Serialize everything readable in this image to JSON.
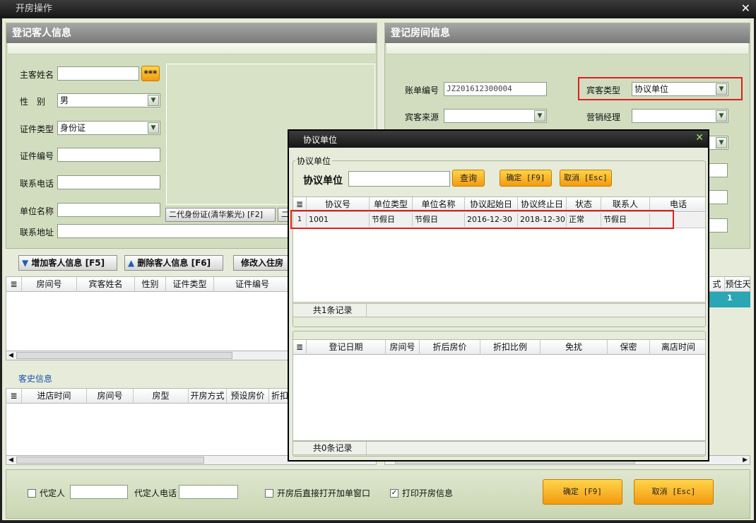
{
  "window": {
    "title": "开房操作",
    "close": "✕"
  },
  "guest_panel": {
    "title": "登记客人信息",
    "fields": {
      "name_label": "主客姓名",
      "name_value": "",
      "more_btn": "***",
      "gender_label": "性　别",
      "gender_value": "男",
      "idtype_label": "证件类型",
      "idtype_value": "身份证",
      "idno_label": "证件编号",
      "idno_value": "",
      "phone_label": "联系电话",
      "phone_value": "",
      "company_label": "单位名称",
      "company_value": "",
      "address_label": "联系地址",
      "address_value": ""
    },
    "id_reader_btn": "二代身份证(清华紫光) [F2]",
    "id_reader_btn2": "二"
  },
  "room_panel": {
    "title": "登记房间信息",
    "bill_label": "账单编号",
    "bill_value": "JZ201612300004",
    "guest_type_label": "宾客类型",
    "guest_type_value": "协议单位",
    "source_label": "宾客来源",
    "source_value": "",
    "manager_label": "营销经理",
    "manager_value": ""
  },
  "guest_toolbar": {
    "add": "增加客人信息 [F5]",
    "delete": "删除客人信息 [F6]",
    "modify": "修改入住房"
  },
  "guest_grid": {
    "columns": [
      "房间号",
      "宾客姓名",
      "性别",
      "证件类型",
      "证件编号"
    ],
    "right_columns": [
      "式",
      "预住天"
    ],
    "right_value": "1"
  },
  "history": {
    "title": "客史信息",
    "columns": [
      "进店时间",
      "房间号",
      "房型",
      "开房方式",
      "预设房价",
      "折扣"
    ]
  },
  "footer": {
    "agent_label": "代定人",
    "agent_value": "",
    "agent_phone_label": "代定人电话",
    "agent_phone_value": "",
    "open_window_label": "开房后直接打开加单窗口",
    "open_window_checked": false,
    "print_label": "打印开房信息",
    "print_checked": true,
    "confirm": "确定 [F9]",
    "cancel": "取消 [Esc]"
  },
  "dialog": {
    "title": "协议单位",
    "close": "✕",
    "group_label": "协议单位",
    "search_label": "协议单位",
    "search_value": "",
    "query_btn": "查询",
    "ok_btn": "确定 [F9]",
    "cancel_btn": "取消 [Esc]",
    "columns": [
      "协议号",
      "单位类型",
      "单位名称",
      "协议起始日",
      "协议终止日",
      "状态",
      "联系人",
      "电话"
    ],
    "rows": [
      {
        "num": "1",
        "cells": [
          "1001",
          "节假日",
          "节假日",
          "2016-12-30",
          "2018-12-30",
          "正常",
          "节假日",
          ""
        ]
      }
    ],
    "record_count": "共1条记录",
    "detail_columns": [
      "登记日期",
      "房间号",
      "折后房价",
      "折扣比例",
      "免扰",
      "保密",
      "离店时间"
    ],
    "detail_count": "共0条记录"
  }
}
